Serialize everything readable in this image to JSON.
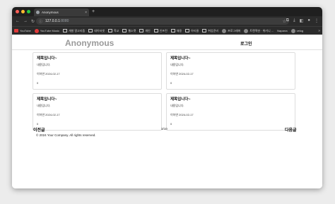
{
  "browser": {
    "tab_title": "Anonymous",
    "tab_close": "×",
    "new_tab": "+",
    "url_host": "127.0.0.1",
    "url_port": ":8080",
    "bookmarks": [
      {
        "label": "YouTube",
        "icon": "youtube-icon"
      },
      {
        "label": "YouTube Music",
        "icon": "youtube-music-icon"
      },
      {
        "label": "개발 알고리즘",
        "icon": "folder-icon"
      },
      {
        "label": "데이터셋",
        "icon": "folder-icon"
      },
      {
        "label": "학교",
        "icon": "folder-icon"
      },
      {
        "label": "웹소켓",
        "icon": "folder-icon"
      },
      {
        "label": "개인",
        "icon": "folder-icon"
      },
      {
        "label": "인프런",
        "icon": "folder-icon"
      },
      {
        "label": "채용",
        "icon": "folder-icon"
      },
      {
        "label": "아티클",
        "icon": "folder-icon"
      },
      {
        "label": "취업준비",
        "icon": "folder-icon"
      },
      {
        "label": "프로그래머",
        "icon": "page-icon"
      },
      {
        "label": "트랜잭션 · 위키니 ...",
        "icon": "page-icon"
      },
      {
        "label": "Naparra",
        "icon": "page-icon"
      },
      {
        "label": "velog",
        "icon": "page-icon"
      }
    ]
  },
  "header": {
    "brand": "Anonymous",
    "login_label": "로그인"
  },
  "posts": [
    {
      "title": "제목입니다~",
      "content": "내용입니다.",
      "author_date": "이하연 2024-02-17",
      "count": "0"
    },
    {
      "title": "제목입니다~",
      "content": "내용입니다.",
      "author_date": "이하연 2024-02-17",
      "count": "0"
    },
    {
      "title": "제목입니다~",
      "content": "내용입니다.",
      "author_date": "이하연 2024-02-17",
      "count": "0"
    },
    {
      "title": "제목입니다~",
      "content": "내용입니다.",
      "author_date": "이하연 2024-02-17",
      "count": "0"
    }
  ],
  "pagination": {
    "prev_label": "이전글",
    "page_indicator": "3/10",
    "next_label": "다음글"
  },
  "footer": {
    "copyright": "© 2024 Your Company. All rights reserved."
  },
  "colors": {
    "close_light": "#ff5f57",
    "minimize_light": "#febc2e",
    "maximize_light": "#28c840",
    "brand_text": "#9a9a9a"
  }
}
